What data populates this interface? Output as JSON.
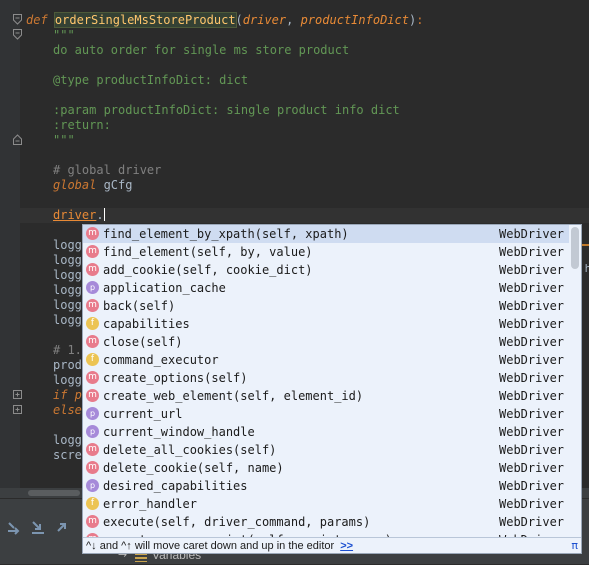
{
  "code": {
    "def_keyword": "def",
    "func_name": "orderSingleMsStoreProduct",
    "open_paren": "(",
    "param1": "driver",
    "comma": ", ",
    "param2": "productInfoDict",
    "close_paren": ")",
    "colon": ":",
    "doc_open": "\"\"\"",
    "doc_line1": "do auto order for single ms store product",
    "doc_line2": "@type productInfoDict: dict",
    "doc_line3": ":param productInfoDict: single product info dict",
    "doc_line4": ":return:",
    "doc_close": "\"\"\"",
    "comment_global": "# global driver",
    "global_keyword": "global",
    "global_var": " gCfg",
    "typing_var": "driver",
    "typing_dot": ".",
    "partial_lines": [
      "logg",
      "logg",
      "logg",
      "logg",
      "logg",
      "logg"
    ],
    "partial_comment": "# 1.",
    "partial_prod": "prod",
    "partial_logg2": "logg",
    "partial_if": "if p",
    "partial_else": "else",
    "partial_logg3": "logg",
    "partial_scre": "scre",
    "right_edge_text": ":h"
  },
  "autocomplete": {
    "items": [
      {
        "kind": "m",
        "name": "find_element_by_xpath(self, xpath)",
        "type": "WebDriver",
        "selected": true
      },
      {
        "kind": "m",
        "name": "find_element(self, by, value)",
        "type": "WebDriver"
      },
      {
        "kind": "m",
        "name": "add_cookie(self, cookie_dict)",
        "type": "WebDriver"
      },
      {
        "kind": "p",
        "name": "application_cache",
        "type": "WebDriver"
      },
      {
        "kind": "m",
        "name": "back(self)",
        "type": "WebDriver"
      },
      {
        "kind": "f",
        "name": "capabilities",
        "type": "WebDriver"
      },
      {
        "kind": "m",
        "name": "close(self)",
        "type": "WebDriver"
      },
      {
        "kind": "f",
        "name": "command_executor",
        "type": "WebDriver"
      },
      {
        "kind": "m",
        "name": "create_options(self)",
        "type": "WebDriver"
      },
      {
        "kind": "m",
        "name": "create_web_element(self, element_id)",
        "type": "WebDriver"
      },
      {
        "kind": "p",
        "name": "current_url",
        "type": "WebDriver"
      },
      {
        "kind": "p",
        "name": "current_window_handle",
        "type": "WebDriver"
      },
      {
        "kind": "m",
        "name": "delete_all_cookies(self)",
        "type": "WebDriver"
      },
      {
        "kind": "m",
        "name": "delete_cookie(self, name)",
        "type": "WebDriver"
      },
      {
        "kind": "p",
        "name": "desired_capabilities",
        "type": "WebDriver"
      },
      {
        "kind": "f",
        "name": "error_handler",
        "type": "WebDriver"
      },
      {
        "kind": "m",
        "name": "execute(self, driver_command, params)",
        "type": "WebDriver"
      },
      {
        "kind": "m",
        "name": "execute_async_script(self, script, args)",
        "type": "WebDriver"
      }
    ],
    "footer_hint": "^↓ and ^↑ will move caret down and up in the editor",
    "footer_more": ">>",
    "footer_pi": "π"
  },
  "bottom_panel": {
    "variables_label": "Variables"
  },
  "colors": {
    "editor_bg": "#2b2b2b",
    "keyword": "#cc7832",
    "function": "#ffc66d",
    "docstring": "#629755",
    "comment": "#808080",
    "popup_bg": "#ecf2fb",
    "popup_selected": "#cfdcf1",
    "badge_method": "#e87b8c",
    "badge_field": "#ecc453",
    "badge_property": "#a68ad9"
  }
}
